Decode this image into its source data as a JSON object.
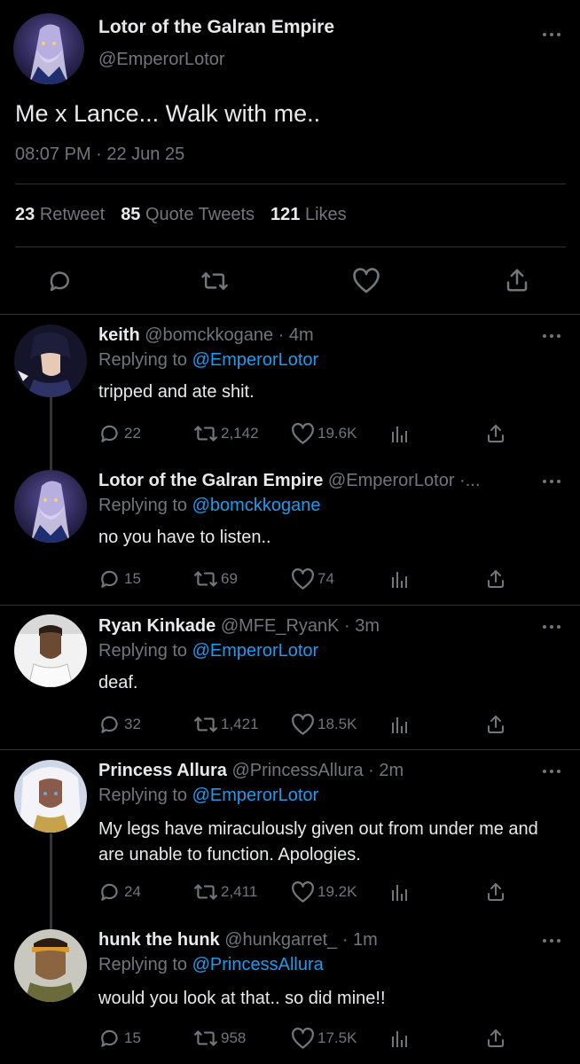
{
  "main_tweet": {
    "name": "Lotor of the Galran Empire",
    "handle": "@EmperorLotor",
    "text": "Me x Lance... Walk with me..",
    "timestamp": "08:07 PM · 22 Jun 25",
    "stats": {
      "retweets": "23",
      "retweets_label": "Retweet",
      "quotes": "85",
      "quotes_label": "Quote Tweets",
      "likes": "121",
      "likes_label": "Likes"
    },
    "actions": [
      "reply-icon",
      "retweet-icon",
      "like-icon",
      "share-icon"
    ]
  },
  "replies": [
    {
      "name": "keith",
      "meta": "@bomckkogane · 4m",
      "replying_label": "Replying to",
      "replying_to": "@EmperorLotor",
      "text": "tripped and ate shit.",
      "replies": "22",
      "retweets": "2,142",
      "likes": "19.6K",
      "avatar_colors": [
        "#1a1b2e",
        "#3b3f6b"
      ]
    },
    {
      "name": "Lotor of the Galran Empire",
      "meta": "@EmperorLotor ·...",
      "replying_label": "Replying to",
      "replying_to": "@bomckkogane",
      "text": "no you have to listen..",
      "replies": "15",
      "retweets": "69",
      "likes": "74",
      "avatar_colors": [
        "#2b2f55",
        "#8f86c8"
      ]
    },
    {
      "name": "Ryan Kinkade",
      "meta": "@MFE_RyanK · 3m",
      "replying_label": "Replying to",
      "replying_to": "@EmperorLotor",
      "text": "deaf.",
      "replies": "32",
      "retweets": "1,421",
      "likes": "18.5K",
      "avatar_colors": [
        "#f2f2f2",
        "#6b4a34"
      ]
    },
    {
      "name": "Princess Allura",
      "meta": "@PrincessAllura · 2m",
      "replying_label": "Replying to",
      "replying_to": "@EmperorLotor",
      "text": "My legs have miraculously given out from under me and are unable to function. Apologies.",
      "replies": "24",
      "retweets": "2,411",
      "likes": "19.2K",
      "avatar_colors": [
        "#dfe6f2",
        "#8a5b4a"
      ]
    },
    {
      "name": "hunk the hunk",
      "meta": "@hunkgarret_ · 1m",
      "replying_label": "Replying to",
      "replying_to": "@PrincessAllura",
      "text": "would you look at that.. so did mine!!",
      "replies": "15",
      "retweets": "958",
      "likes": "17.5K",
      "avatar_colors": [
        "#c9c8bf",
        "#7a5a3a"
      ]
    }
  ],
  "colors": {
    "background": "#000000",
    "text": "#e7e9ea",
    "secondary": "#71767b",
    "link": "#1d9bf0",
    "divider": "#2f3336"
  }
}
